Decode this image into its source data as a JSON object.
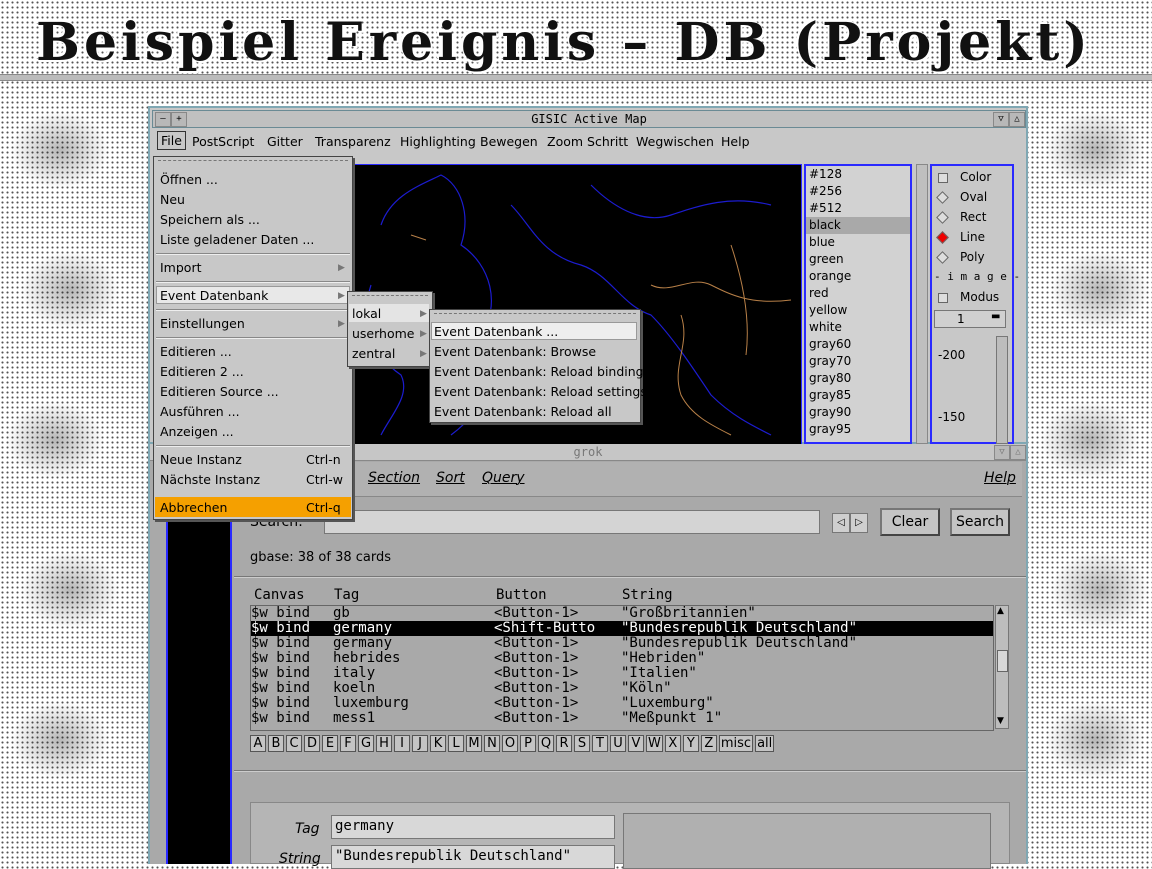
{
  "slide": {
    "title": "Beispiel  Ereignis – DB  (Projekt)"
  },
  "map_window": {
    "title": "GISIC Active Map",
    "menu": [
      "File",
      "PostScript",
      "Gitter",
      "Transparenz",
      "Highlighting",
      "Bewegen",
      "Zoom Schritt",
      "Wegwischen",
      "Help"
    ],
    "colors": [
      "#128",
      "#256",
      "#512",
      "black",
      "blue",
      "green",
      "orange",
      "red",
      "yellow",
      "white",
      "gray60",
      "gray70",
      "gray80",
      "gray85",
      "gray90",
      "gray95"
    ],
    "selected_color": "black",
    "tools": {
      "color": "Color",
      "oval": "Oval",
      "rect": "Rect",
      "line": "Line",
      "poly": "Poly",
      "image_header": "- i m a g e -",
      "modus": "Modus",
      "spin_value": "1",
      "scale_1": "-200",
      "scale_2": "-150"
    }
  },
  "file_menu": {
    "oeffnen": "Öffnen ...",
    "neu": "Neu",
    "speichern": "Speichern als ...",
    "liste": "Liste geladener Daten ...",
    "import": "Import",
    "event": "Event Datenbank",
    "einstellungen": "Einstellungen",
    "editieren": "Editieren ...",
    "editieren2": "Editieren 2 ...",
    "editieren_source": "Editieren Source ...",
    "ausfuehren": "Ausführen ...",
    "anzeigen": "Anzeigen ...",
    "neue_instanz": "Neue Instanz",
    "neue_instanz_key": "Ctrl-n",
    "naechste_instanz": "Nächste Instanz",
    "naechste_instanz_key": "Ctrl-w",
    "abbrechen": "Abbrechen",
    "abbrechen_key": "Ctrl-q"
  },
  "submenu_1": {
    "lokal": "lokal",
    "userhome": "userhome",
    "zentral": "zentral"
  },
  "submenu_2": {
    "item1": "Event Datenbank ...",
    "item2": "Event Datenbank: Browse",
    "item3": "Event Datenbank: Reload bindings",
    "item4": "Event Datenbank: Reload settings",
    "item5": "Event Datenbank: Reload all"
  },
  "grok": {
    "title": "grok",
    "menu": {
      "section": "Section",
      "sort": "Sort",
      "query": "Query",
      "help": "Help"
    },
    "search_label": "Search:",
    "search_value": "",
    "clear": "Clear",
    "search_button": "Search",
    "status": "gbase: 38 of 38 cards",
    "columns": {
      "canvas": "Canvas",
      "tag": "Tag",
      "button": "Button",
      "string": "String"
    },
    "rows": [
      [
        "$w bind",
        "gb",
        "<Button-1>",
        "\"Großbritannien\""
      ],
      [
        "$w bind",
        "germany",
        "<Shift-Butto",
        "\"Bundesrepublik Deutschland\""
      ],
      [
        "$w bind",
        "germany",
        "<Button-1>",
        "\"Bundesrepublik Deutschland\""
      ],
      [
        "$w bind",
        "hebrides",
        "<Button-1>",
        "\"Hebriden\""
      ],
      [
        "$w bind",
        "italy",
        "<Button-1>",
        "\"Italien\""
      ],
      [
        "$w bind",
        "koeln",
        "<Button-1>",
        "\"Köln\""
      ],
      [
        "$w bind",
        "luxemburg",
        "<Button-1>",
        "\"Luxemburg\""
      ],
      [
        "$w bind",
        "mess1",
        "<Button-1>",
        "\"Meßpunkt 1\""
      ]
    ],
    "alphabet": [
      "A",
      "B",
      "C",
      "D",
      "E",
      "F",
      "G",
      "H",
      "I",
      "J",
      "K",
      "L",
      "M",
      "N",
      "O",
      "P",
      "Q",
      "R",
      "S",
      "T",
      "U",
      "V",
      "W",
      "X",
      "Y",
      "Z",
      "misc",
      "all"
    ],
    "form": {
      "tag_label": "Tag",
      "tag_value": "germany",
      "string_label": "String",
      "string_value": "\"Bundesrepublik Deutschland\""
    }
  },
  "colors": {
    "accent_blue": "#2a2aff",
    "menu_highlight": "#f5a000",
    "selection": "#000000"
  }
}
